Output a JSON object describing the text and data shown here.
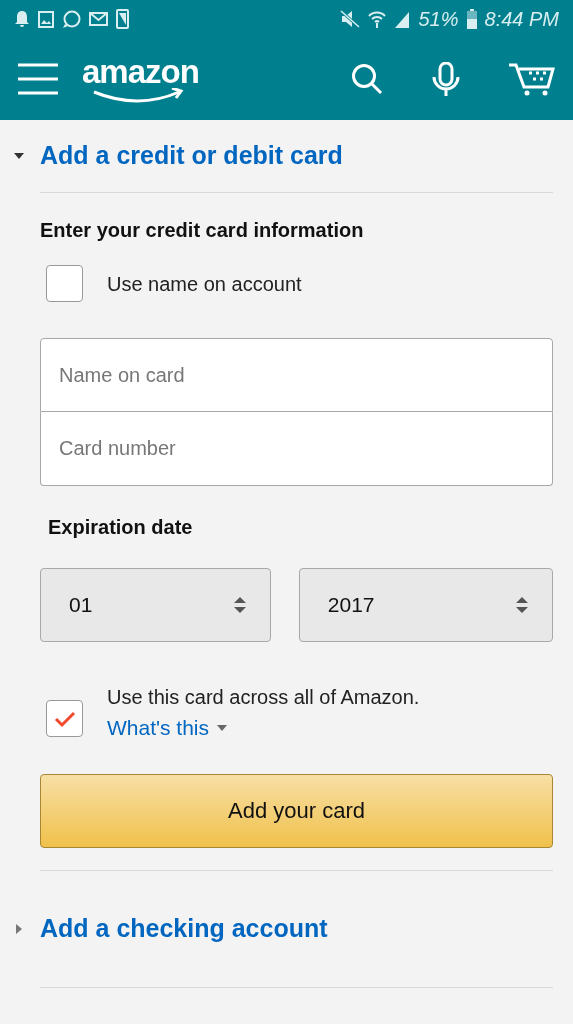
{
  "status_bar": {
    "battery": "51%",
    "time": "8:44 PM"
  },
  "header": {
    "logo": "amazon"
  },
  "sections": [
    {
      "title": "Add a credit or debit card",
      "expanded": true
    },
    {
      "title": "Add a checking account",
      "expanded": false
    }
  ],
  "card_form": {
    "heading": "Enter your credit card information",
    "use_name": {
      "label": "Use name on account",
      "checked": false
    },
    "fields": [
      {
        "placeholder": "Name on card"
      },
      {
        "placeholder": "Card number"
      }
    ],
    "expiration": {
      "label": "Expiration date",
      "month": "01",
      "year": "2017"
    },
    "use_across": {
      "label": "Use this card across all of Amazon.",
      "checked": true,
      "link": "What's this"
    },
    "submit": "Add your card"
  }
}
